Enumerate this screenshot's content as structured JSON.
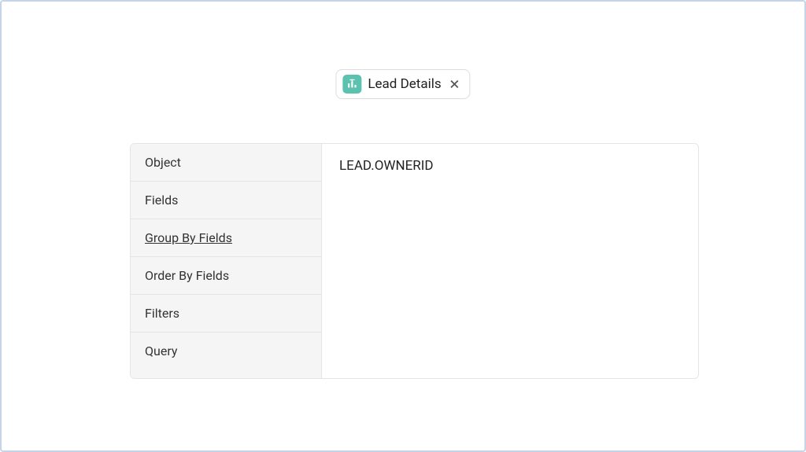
{
  "chip": {
    "label": "Lead Details"
  },
  "sidebar": {
    "items": [
      {
        "label": "Object"
      },
      {
        "label": "Fields"
      },
      {
        "label": "Group By Fields"
      },
      {
        "label": "Order By Fields"
      },
      {
        "label": "Filters"
      },
      {
        "label": "Query"
      }
    ],
    "active_index": 2
  },
  "content": {
    "value": "LEAD.OWNERID"
  }
}
